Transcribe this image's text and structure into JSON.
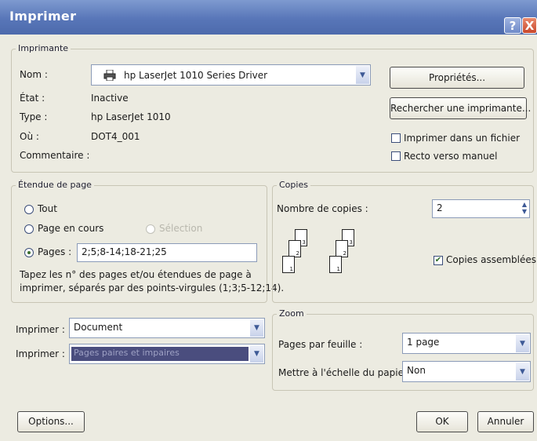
{
  "window": {
    "title": "Imprimer",
    "help_glyph": "?",
    "close_glyph": "X"
  },
  "printer": {
    "legend": "Imprimante",
    "name_label": "Nom :",
    "name_value": "hp LaserJet 1010 Series Driver",
    "status_label": "État :",
    "status_value": "Inactive",
    "type_label": "Type :",
    "type_value": "hp LaserJet 1010",
    "where_label": "Où :",
    "where_value": "DOT4_001",
    "comment_label": "Commentaire :",
    "properties_button": "Propriétés...",
    "find_button": "Rechercher une imprimante...",
    "print_to_file_label": "Imprimer dans un fichier",
    "print_to_file_checked": false,
    "manual_duplex_label": "Recto verso manuel",
    "manual_duplex_checked": false
  },
  "page_range": {
    "legend": "Étendue de page",
    "all_label": "Tout",
    "current_label": "Page en cours",
    "selection_label": "Sélection",
    "pages_label": "Pages :",
    "pages_value": "2;5;8-14;18-21;25",
    "selected": "pages",
    "hint_line1": "Tapez les n° des pages et/ou étendues de page à",
    "hint_line2": "imprimer, séparés par des points-virgules (1;3;5-12;14)."
  },
  "copies": {
    "legend": "Copies",
    "count_label": "Nombre de copies :",
    "count_value": "2",
    "collate_label": "Copies assemblées",
    "collate_checked": true,
    "sheet_numbers": [
      "1",
      "2",
      "3"
    ]
  },
  "print_what": {
    "what_label": "Imprimer :",
    "what_value": "Document",
    "which_label": "Imprimer :",
    "which_value": "Pages paires et impaires"
  },
  "zoom": {
    "legend": "Zoom",
    "pages_per_sheet_label": "Pages par feuille :",
    "pages_per_sheet_value": "1 page",
    "scale_label": "Mettre à l'échelle du papier :",
    "scale_value": "Non"
  },
  "footer": {
    "options_button": "Options...",
    "ok_button": "OK",
    "cancel_button": "Annuler"
  },
  "colors": {
    "titlebar": "#5876b8",
    "highlight": "#4a4d7e",
    "check_mark": "#2f6e2a"
  },
  "icons": {
    "printer": "printer-icon",
    "dropdown": "chevron-down-icon",
    "spinner": "spinner-icon"
  }
}
